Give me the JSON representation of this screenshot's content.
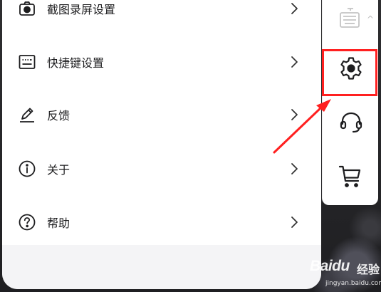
{
  "menu": {
    "items": [
      {
        "label": "截图录屏设置",
        "icon": "camera-icon"
      },
      {
        "label": "快捷键设置",
        "icon": "keyboard-shortcut-icon"
      },
      {
        "label": "反馈",
        "icon": "pencil-icon"
      },
      {
        "label": "关于",
        "icon": "info-icon"
      },
      {
        "label": "帮助",
        "icon": "help-icon"
      }
    ]
  },
  "toolbar": {
    "buttons": [
      {
        "name": "keyboard-icon",
        "badge": "^"
      },
      {
        "name": "gear-icon"
      },
      {
        "name": "headset-icon"
      },
      {
        "name": "cart-icon"
      }
    ]
  },
  "annotation": {
    "highlight_color": "#ff2020"
  },
  "watermark": {
    "brand": "Baidu",
    "site": "经验",
    "url": "jingyan.baidu.com"
  }
}
